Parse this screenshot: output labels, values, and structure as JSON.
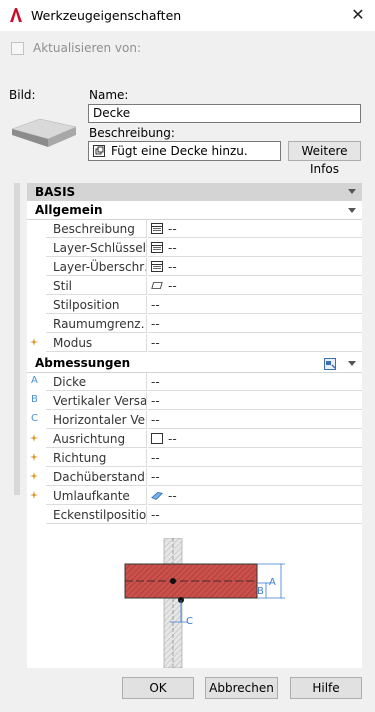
{
  "window": {
    "title": "Werkzeugeigenschaften",
    "close_glyph": "✕"
  },
  "update_checkbox": {
    "label": "Aktualisieren von:",
    "checked": false
  },
  "image": {
    "label": "Bild:"
  },
  "name": {
    "label": "Name:",
    "value": "Decke"
  },
  "description": {
    "label": "Beschreibung:",
    "value": "Fügt eine Decke hinzu.",
    "more_button": "Weitere Infos"
  },
  "panel": {
    "basis_header": "BASIS",
    "general": {
      "header": "Allgemein",
      "rows": [
        {
          "name": "Beschreibung",
          "value": "--",
          "icon": "table-icon"
        },
        {
          "name": "Layer-Schlüssel",
          "value": "--",
          "icon": "table-icon"
        },
        {
          "name": "Layer-Überschr…",
          "value": "--",
          "icon": "table-icon"
        },
        {
          "name": "Stil",
          "value": "--",
          "icon": "parallelogram-icon"
        },
        {
          "name": "Stilposition",
          "value": "--"
        },
        {
          "name": "Raumumgrenz…",
          "value": "--"
        },
        {
          "name": "Modus",
          "value": "--",
          "marker": "star"
        }
      ]
    },
    "dimensions": {
      "header": "Abmessungen",
      "rows": [
        {
          "name": "Dicke",
          "value": "--",
          "marker": "A"
        },
        {
          "name": "Vertikaler Versa…",
          "value": "--",
          "marker": "B"
        },
        {
          "name": "Horizontaler Ve…",
          "value": "--",
          "marker": "C"
        },
        {
          "name": "Ausrichtung",
          "value": "--",
          "marker": "star",
          "icon": "square-icon"
        },
        {
          "name": "Richtung",
          "value": "--",
          "marker": "star"
        },
        {
          "name": "Dachüberstand",
          "value": "--",
          "marker": "star"
        },
        {
          "name": "Umlaufkante",
          "value": "--",
          "marker": "star",
          "icon": "edge-icon"
        },
        {
          "name": "Eckenstilposition",
          "value": "--"
        }
      ]
    },
    "diagram_labels": {
      "a": "A",
      "b": "B",
      "c": "C"
    }
  },
  "buttons": {
    "ok": "OK",
    "cancel": "Abbrechen",
    "help": "Hilfe"
  }
}
